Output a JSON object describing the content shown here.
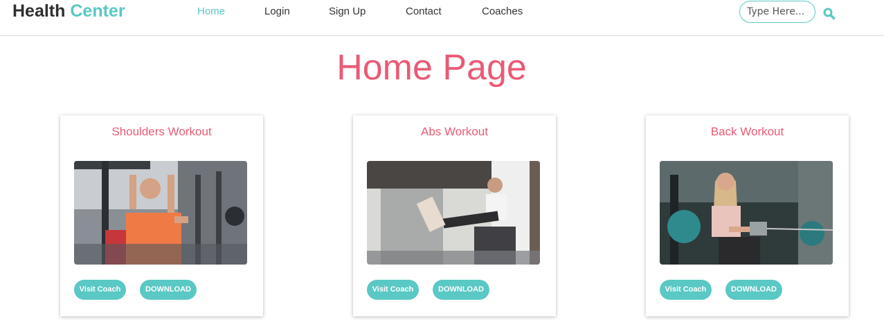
{
  "brand": {
    "part1": "Health",
    "part2": "Center"
  },
  "nav": {
    "items": [
      {
        "label": "Home",
        "active": true
      },
      {
        "label": "Login"
      },
      {
        "label": "Sign Up"
      },
      {
        "label": "Contact"
      },
      {
        "label": "Coaches"
      }
    ]
  },
  "search": {
    "placeholder": "Type Here...",
    "value": "",
    "icon": "search-icon"
  },
  "page": {
    "title": "Home Page"
  },
  "cards": [
    {
      "title": "Shoulders Workout",
      "image": "man-shoulder-press-photo",
      "visit_label": "Visit Coach",
      "download_label": "DOWNLOAD"
    },
    {
      "title": "Abs Workout",
      "image": "woman-abs-workout-photo",
      "visit_label": "Visit Coach",
      "download_label": "DOWNLOAD"
    },
    {
      "title": "Back Workout",
      "image": "woman-cable-row-photo",
      "visit_label": "Visit Coach",
      "download_label": "DOWNLOAD"
    }
  ],
  "colors": {
    "accent": "#5ac8c4",
    "title": "#ea5a74",
    "text": "#2f2f2f"
  }
}
